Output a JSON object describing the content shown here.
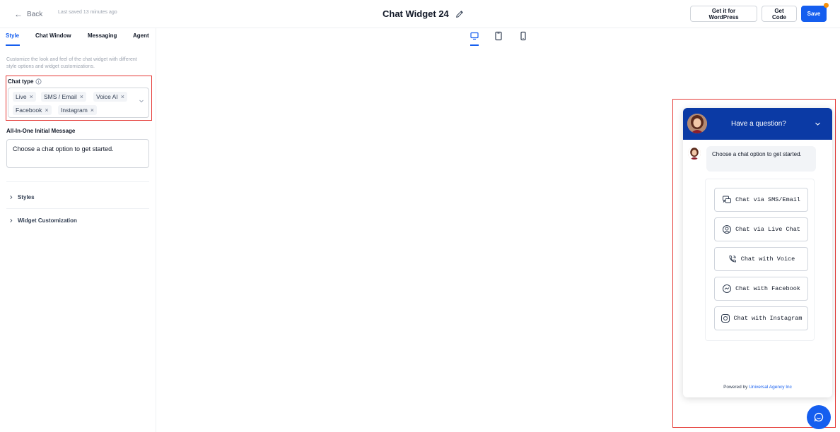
{
  "header": {
    "back_label": "Back",
    "last_saved": "Last saved 13 minutes ago",
    "title": "Chat Widget 24",
    "btn_wordpress": "Get it for WordPress",
    "btn_get_code": "Get Code",
    "btn_save": "Save"
  },
  "tabs": [
    {
      "label": "Style",
      "active": true
    },
    {
      "label": "Chat Window",
      "active": false
    },
    {
      "label": "Messaging",
      "active": false
    },
    {
      "label": "Agent",
      "active": false
    }
  ],
  "style_panel": {
    "description": "Customize the look and feel of the chat widget with different style options and widget customizations.",
    "chat_type_label": "Chat type",
    "chat_types": [
      "Live",
      "SMS / Email",
      "Voice AI",
      "Facebook",
      "Instagram"
    ],
    "initial_message_label": "All-In-One Initial Message",
    "initial_message_value": "Choose a chat option to get started.",
    "accordions": [
      "Styles",
      "Widget Customization"
    ]
  },
  "devices": [
    "desktop-icon",
    "tablet-icon",
    "mobile-icon"
  ],
  "widget": {
    "header_title": "Have a question?",
    "message": "Choose a chat option to get started.",
    "options": [
      {
        "label": "Chat via SMS/Email",
        "icon": "sms-chat-icon"
      },
      {
        "label": "Chat via Live Chat",
        "icon": "live-chat-icon"
      },
      {
        "label": "Chat with Voice",
        "icon": "phone-voice-icon"
      },
      {
        "label": "Chat with Facebook",
        "icon": "messenger-icon"
      },
      {
        "label": "Chat with Instagram",
        "icon": "instagram-icon"
      }
    ],
    "powered_by_prefix": "Powered by",
    "powered_by_link": "Universal Agency Inc"
  },
  "colors": {
    "accent": "#155eef",
    "widget_header": "#0b3aa5",
    "highlight_border": "#e53935",
    "notification_dot": "#f79009"
  }
}
